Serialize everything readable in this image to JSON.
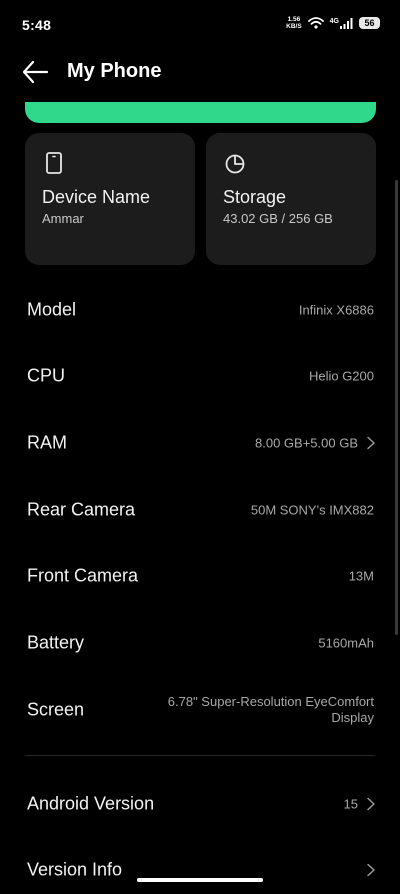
{
  "status_bar": {
    "time": "5:48",
    "net_speed_value": "1.56",
    "net_speed_unit": "KB/S",
    "lte": "4G",
    "battery": "56"
  },
  "header": {
    "title": "My Phone"
  },
  "cards": [
    {
      "title": "Device Name",
      "value": "Ammar",
      "icon": "phone-icon"
    },
    {
      "title": "Storage",
      "value": "43.02 GB / 256 GB",
      "icon": "pie-chart-icon"
    }
  ],
  "specs": [
    {
      "label": "Model",
      "value": "Infinix X6886"
    },
    {
      "label": "CPU",
      "value": "Helio G200"
    },
    {
      "label": "RAM",
      "value": "8.00 GB+5.00 GB"
    },
    {
      "label": "Rear Camera",
      "value": "50M SONY's IMX882"
    },
    {
      "label": "Front Camera",
      "value": "13M"
    },
    {
      "label": "Battery",
      "value": "5160mAh"
    },
    {
      "label": "Screen",
      "value": "6.78\" Super-Resolution EyeComfort Display"
    }
  ],
  "system": [
    {
      "label": "Android Version",
      "value": "15"
    },
    {
      "label": "Version Info",
      "value": ""
    }
  ],
  "colors": {
    "accent": "#2fd88a",
    "card_bg": "#1c1c1c",
    "background": "#000000"
  }
}
